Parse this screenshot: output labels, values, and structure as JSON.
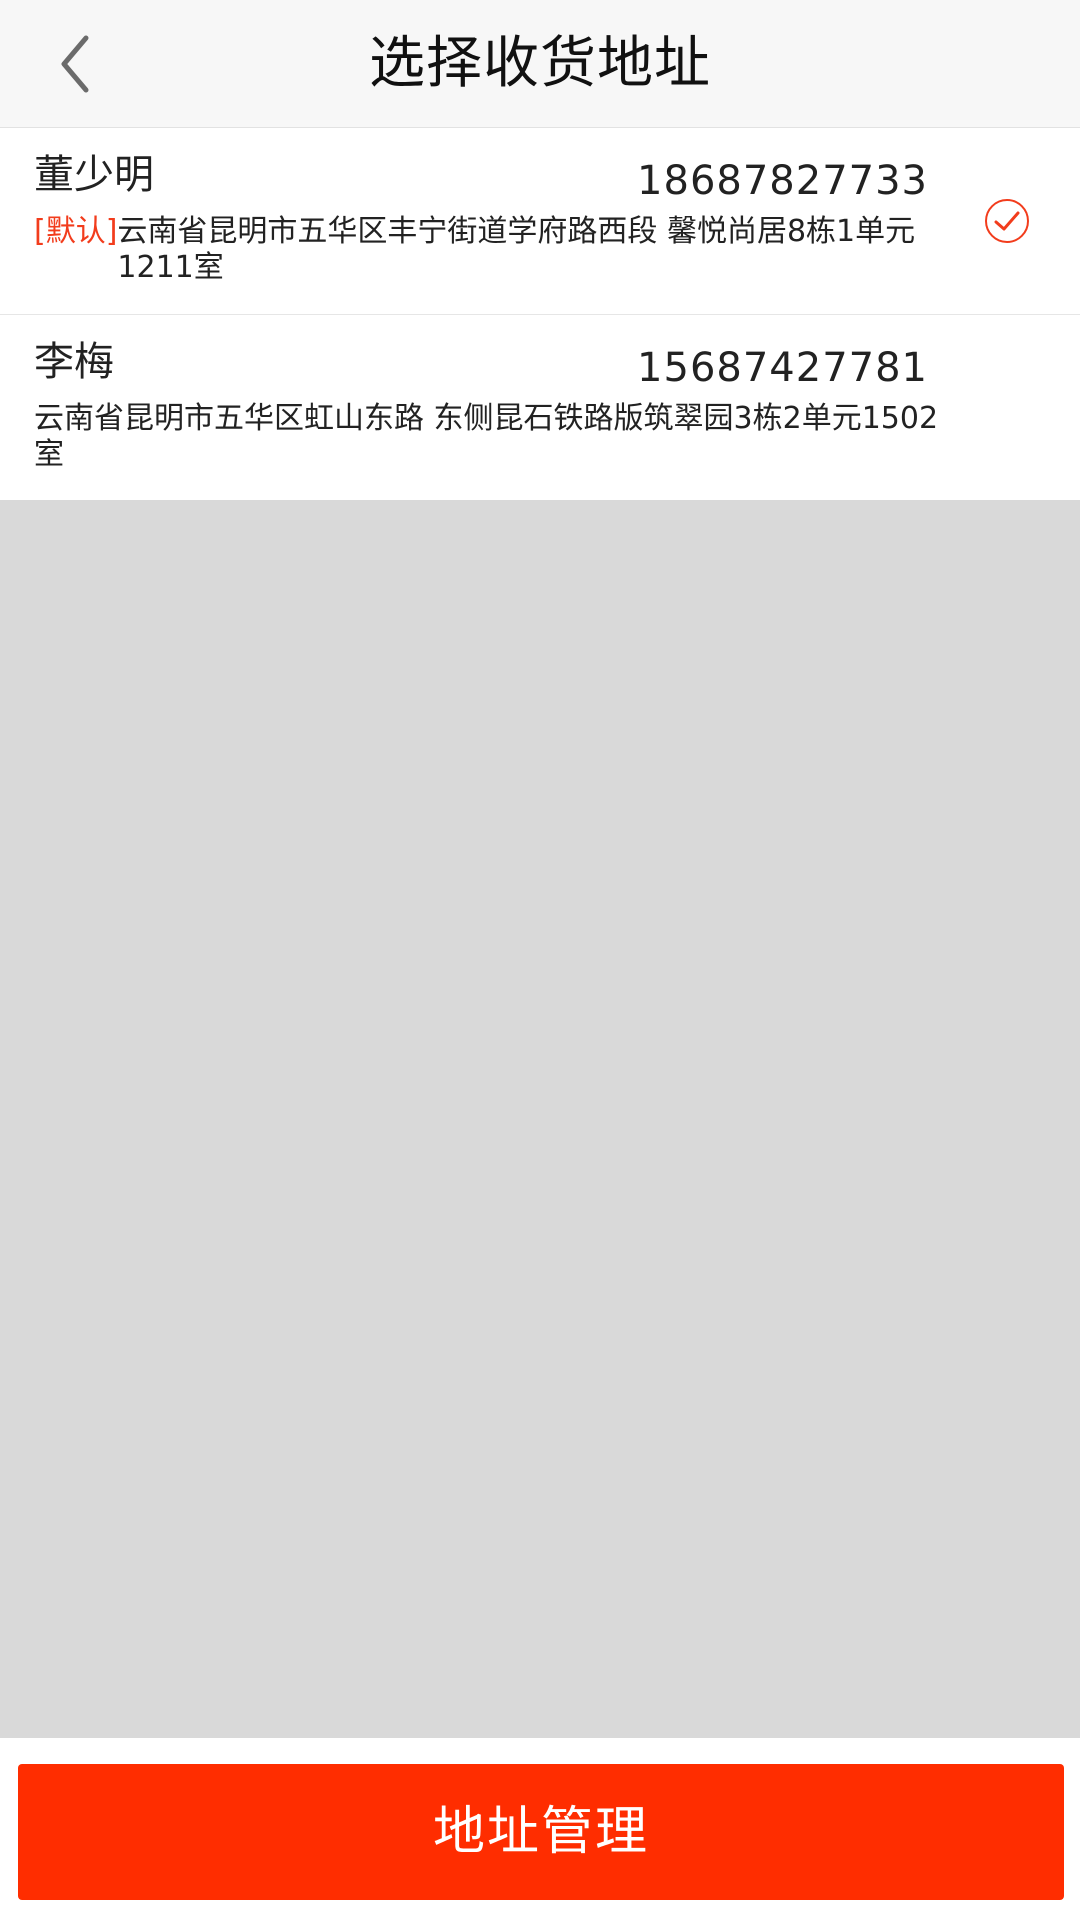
{
  "navbar": {
    "title": "选择收货地址",
    "back_icon": "chevron-left-icon"
  },
  "addresses": [
    {
      "name": "董少明",
      "phone": "18687827733",
      "default_tag": "[默认]",
      "address": "云南省昆明市五华区丰宁街道学府路西段 馨悦尚居8栋1单元1211室",
      "selected": true
    },
    {
      "name": "李梅",
      "phone": "15687427781",
      "default_tag": "",
      "address": "云南省昆明市五华区虹山东路 东侧昆石铁路版筑翠园3栋2单元1502室",
      "selected": false
    }
  ],
  "footer": {
    "manage_label": "地址管理"
  },
  "colors": {
    "accent": "#ff2d00",
    "tag": "#f23c1c",
    "navbar_bg": "#f7f7f7",
    "page_bg": "#d9d9d9"
  },
  "icons": {
    "selected": "check-circle-icon"
  }
}
